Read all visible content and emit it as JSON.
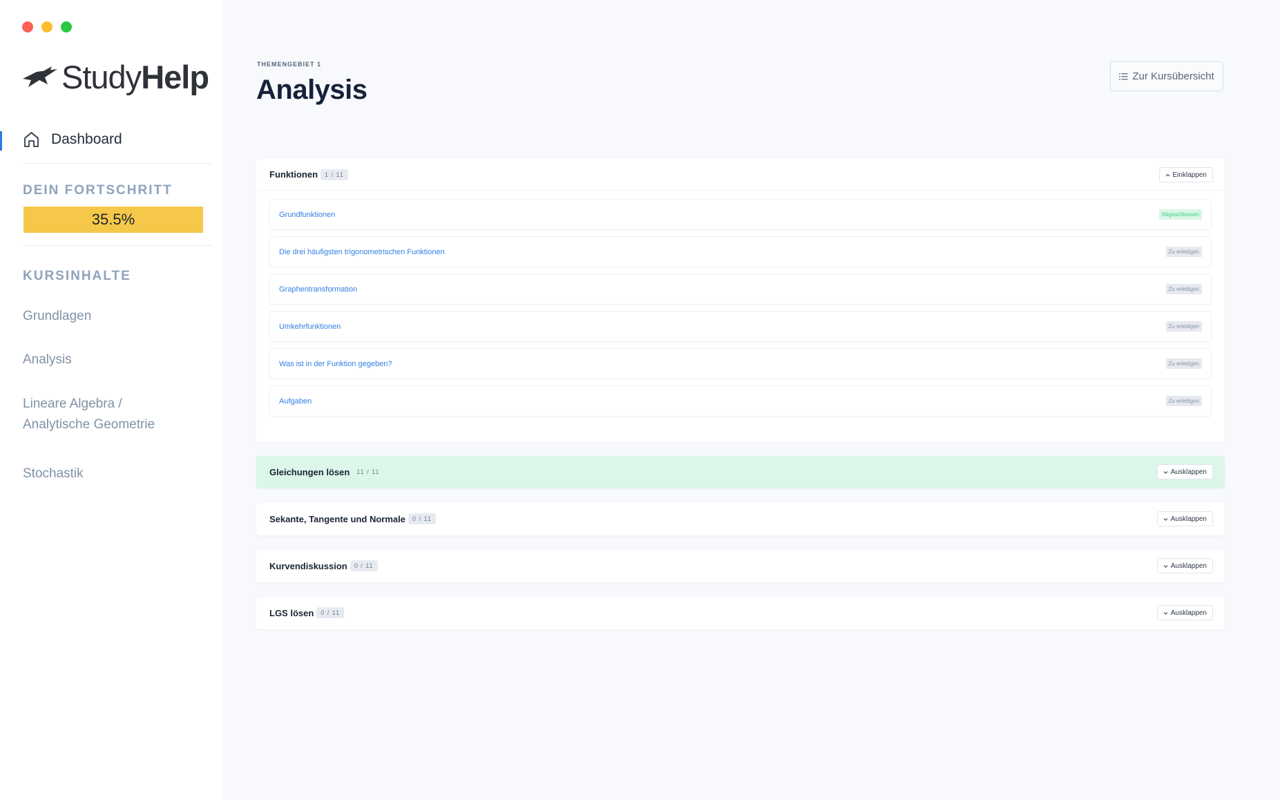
{
  "window": {
    "controls": [
      "close",
      "minimize",
      "zoom"
    ]
  },
  "brand": {
    "logo_part1": "Study",
    "logo_part2": "Help",
    "icon": "graduation-cap-icon"
  },
  "sidebar": {
    "dashboard_label": "Dashboard",
    "dashboard_icon": "home-icon",
    "progress_title": "DEIN FORTSCHRITT",
    "progress_value": "35.5%",
    "progress_fraction": 0.355,
    "progress_color": "#f5c849",
    "content_title": "KURSINHALTE",
    "courses": [
      "Grundlagen",
      "Analysis",
      "Lineare Algebra / Analytische Geometrie",
      "Stochastik"
    ]
  },
  "main": {
    "eyebrow": "THEMENGEBIET 1",
    "title": "Analysis",
    "overview_button": "Zur Kursübersicht",
    "overview_icon": "list-icon",
    "sections": [
      {
        "title": "Funktionen",
        "count": "1 / 11",
        "toggle": "Einklappen",
        "expanded": true,
        "items": [
          {
            "label": "Grundfunktionen",
            "status": "Abgeschlossen",
            "done": true
          },
          {
            "label": "Die drei häufigsten trigonometrischen Funktionen",
            "status": "Zu erledigen",
            "done": false
          },
          {
            "label": "Graphentransformation",
            "status": "Zu erledigen",
            "done": false
          },
          {
            "label": "Umkehrfunktionen",
            "status": "Zu erledigen",
            "done": false
          },
          {
            "label": "Was ist in der Funktion gegeben?",
            "status": "Zu erledigen",
            "done": false
          },
          {
            "label": "Aufgaben",
            "status": "Zu erledigen",
            "done": false
          }
        ]
      },
      {
        "title": "Gleichungen lösen",
        "count": "11 / 11",
        "toggle": "Ausklappen",
        "expanded": false,
        "complete": true
      },
      {
        "title": "Sekante, Tangente und Normale",
        "count": "0 / 11",
        "toggle": "Ausklappen",
        "expanded": false
      },
      {
        "title": "Kurvendiskussion",
        "count": "0 / 11",
        "toggle": "Ausklappen",
        "expanded": false
      },
      {
        "title": "LGS lösen",
        "count": "0 / 11",
        "toggle": "Ausklappen",
        "expanded": false
      }
    ]
  },
  "colors": {
    "accent": "#2b7be4",
    "complete_bg": "#dcf6ea",
    "done_text": "#3fcf86"
  }
}
